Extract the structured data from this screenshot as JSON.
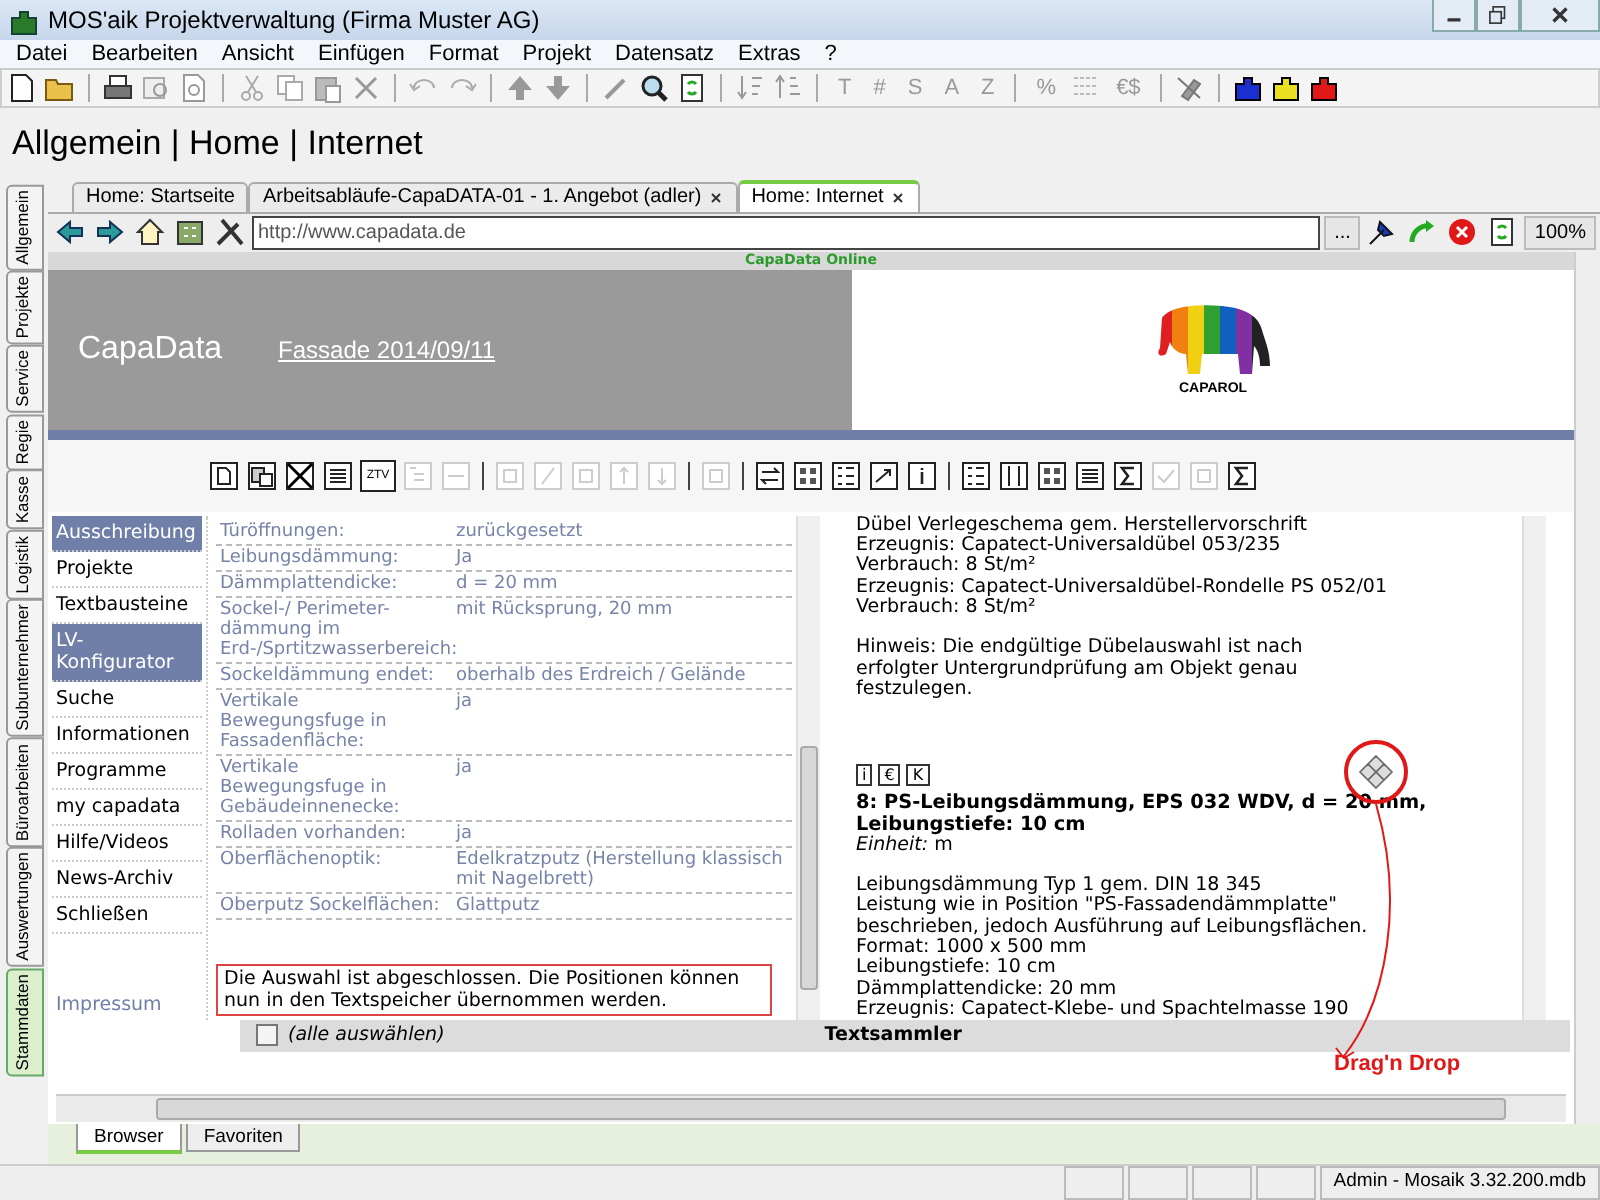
{
  "window": {
    "title": "MOS'aik Projektverwaltung (Firma Muster AG)"
  },
  "menu": [
    "Datei",
    "Bearbeiten",
    "Ansicht",
    "Einfügen",
    "Format",
    "Projekt",
    "Datensatz",
    "Extras",
    "?"
  ],
  "toolbar": {
    "letters": [
      "T",
      "#",
      "S",
      "A",
      "Z"
    ],
    "percent": "%",
    "currency": "€$"
  },
  "heading": "Allgemein | Home | Internet",
  "side_tabs": [
    {
      "label": "Allgemein",
      "selected": false
    },
    {
      "label": "Projekte",
      "selected": false
    },
    {
      "label": "Service",
      "selected": false
    },
    {
      "label": "Regie",
      "selected": false
    },
    {
      "label": "Kasse",
      "selected": false
    },
    {
      "label": "Logistik",
      "selected": false
    },
    {
      "label": "Subunternehmer",
      "selected": false
    },
    {
      "label": "Büroarbeiten",
      "selected": false
    },
    {
      "label": "Auswertungen",
      "selected": false
    },
    {
      "label": "Stammdaten",
      "selected": true
    }
  ],
  "doc_tabs": [
    {
      "label": "Home: Startseite",
      "closable": false,
      "selected": false
    },
    {
      "label": "Arbeitsabläufe-CapaDATA-01 - 1. Angebot (adler)",
      "closable": true,
      "selected": false
    },
    {
      "label": "Home: Internet",
      "closable": true,
      "selected": true
    }
  ],
  "address_bar": {
    "url": "http://www.capadata.de",
    "more": "...",
    "zoom": "100%"
  },
  "browser": {
    "caption": "CapaData Online",
    "banner": {
      "brand": "CapaData",
      "link": "Fassade 2014/09/11",
      "logo_text": "CAPAROL"
    },
    "toolbar_label": "ZTV",
    "nav": [
      {
        "label": "Ausschreibung",
        "selected": true
      },
      {
        "label": "Projekte",
        "selected": false
      },
      {
        "label": "Textbausteine",
        "selected": false
      },
      {
        "label": "LV-Konfigurator",
        "selected": true
      },
      {
        "label": "Suche",
        "selected": false
      },
      {
        "label": "Informationen",
        "selected": false
      },
      {
        "label": "Programme",
        "selected": false
      },
      {
        "label": "my capadata",
        "selected": false
      },
      {
        "label": "Hilfe/Videos",
        "selected": false
      },
      {
        "label": "News-Archiv",
        "selected": false
      },
      {
        "label": "Schließen",
        "selected": false
      }
    ],
    "impressum": "Impressum",
    "properties": [
      {
        "label": "Türöffnungen:",
        "value": "zurückgesetzt"
      },
      {
        "label": "Leibungsdämmung:",
        "value": "Ja"
      },
      {
        "label": "Dämmplattendicke:",
        "value": "d = 20 mm"
      },
      {
        "label": "Sockel-/ Perimeter-dämmung im Erd-/Sprtitzwasserbereich:",
        "value": "mit Rücksprung, 20 mm"
      },
      {
        "label": "Sockeldämmung endet:",
        "value": "oberhalb des Erdreich / Gelände"
      },
      {
        "label": "Vertikale Bewegungsfuge in Fassadenfläche:",
        "value": "ja"
      },
      {
        "label": "Vertikale Bewegungsfuge in Gebäudeinnenecke:",
        "value": "ja"
      },
      {
        "label": "Rolladen vorhanden:",
        "value": "ja"
      },
      {
        "label": "Oberflächenoptik:",
        "value": "Edelkratzputz (Herstellung klassisch mit Nagelbrett)"
      },
      {
        "label": "Oberputz Sockelflächen:",
        "value": "Glattputz"
      }
    ],
    "message": "Die Auswahl ist abgeschlossen. Die Positionen können nun in den Textspeicher übernommen werden.",
    "select_all": {
      "label": "(alle auswählen)",
      "checked": false
    },
    "collector_title": "Textsammler",
    "description": [
      {
        "kind": "text",
        "lines": [
          "Dübel Verlegeschema gem. Herstellervorschrift",
          "Erzeugnis: Capatect-Universaldübel 053/235",
          "Verbrauch: 8 St/m²",
          "Erzeugnis: Capatect-Universaldübel-Rondelle PS 052/01",
          "Verbrauch: 8 St/m²"
        ]
      },
      {
        "kind": "text",
        "lines": [
          "Hinweis: Die endgültige Dübelauswahl ist nach",
          "erfolgter Untergrundprüfung am Objekt genau",
          "festzulegen."
        ]
      },
      {
        "kind": "icons",
        "items": [
          "i",
          "€",
          "K"
        ]
      },
      {
        "kind": "title",
        "lines": [
          "8: PS-Leibungsdämmung, EPS 032 WDV, d = 20 mm,",
          "Leibungstiefe: 10 cm"
        ],
        "unit": "*Einheit:* m"
      },
      {
        "kind": "text",
        "lines": [
          "Leibungsdämmung Typ 1 gem. DIN 18 345",
          "Leistung wie in Position \"PS-Fassadendämmplatte\"",
          "beschrieben, jedoch Ausführung auf Leibungsflächen.",
          "Format: 1000 x 500 mm",
          "Leibungstiefe: 10 cm",
          "Dämmplattendicke: 20 mm",
          "Erzeugnis: Capatect-Klebe- und Spachtelmasse 190"
        ]
      }
    ]
  },
  "annotation": {
    "label": "Drag'n Drop"
  },
  "bottom_tabs": [
    {
      "label": "Browser",
      "selected": true
    },
    {
      "label": "Favoriten",
      "selected": false
    }
  ],
  "status_bar": {
    "text": "Admin - Mosaik 3.32.200.mdb"
  }
}
